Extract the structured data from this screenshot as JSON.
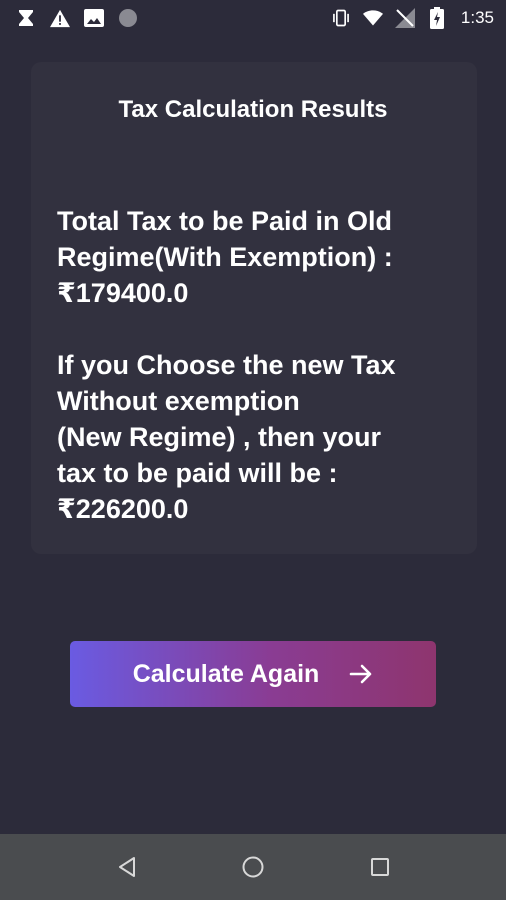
{
  "status_bar": {
    "time": "1:35",
    "left_icons": [
      "hourglass-icon",
      "warning-icon",
      "image-icon",
      "circle-icon"
    ],
    "right_icons": [
      "vibrate-icon",
      "wifi-icon",
      "no-signal-icon",
      "battery-icon"
    ]
  },
  "card": {
    "title": "Tax Calculation Results",
    "old_regime_lines": [
      "Total Tax to be Paid in Old",
      "Regime(With Exemption) :",
      "₹179400.0"
    ],
    "new_regime_lines": [
      "If you Choose the new Tax",
      "Without exemption",
      "(New Regime) , then your",
      "tax to be paid will be :",
      "₹226200.0"
    ]
  },
  "button": {
    "label": "Calculate Again",
    "icon": "arrow-right-icon"
  },
  "nav_bar": {
    "buttons": [
      "back-icon",
      "home-icon",
      "recents-icon"
    ]
  },
  "colors": {
    "background": "#2c2b3a",
    "card": "#32313f",
    "button_gradient_start": "#6a5be2",
    "button_gradient_end": "#8e356e",
    "nav_bar": "#4a4c4f"
  }
}
